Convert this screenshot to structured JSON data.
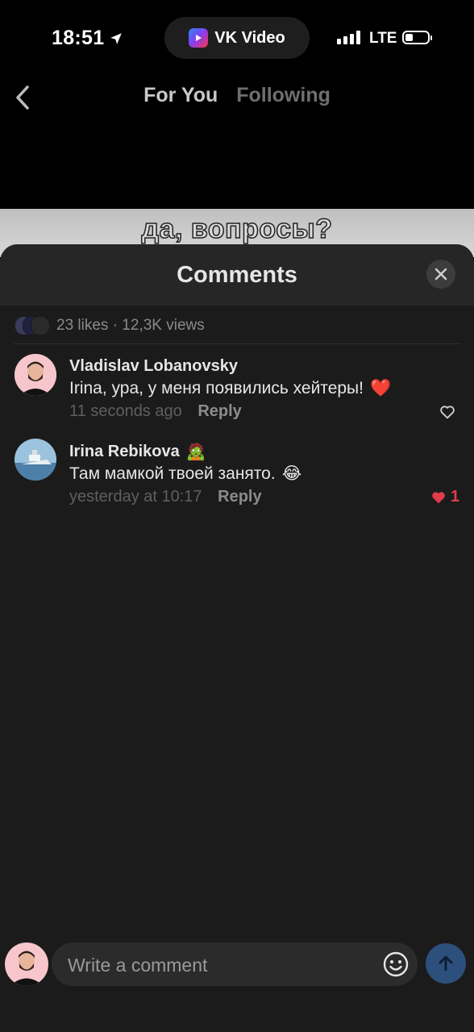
{
  "status_bar": {
    "time": "18:51",
    "network": "LTE",
    "app_pill": "VK Video"
  },
  "nav": {
    "tabs": [
      {
        "label": "For You",
        "active": true
      },
      {
        "label": "Following",
        "active": false
      }
    ]
  },
  "video": {
    "caption": "да, вопросы?"
  },
  "comments_sheet": {
    "title": "Comments",
    "stats": "23 likes · 12,3K views",
    "comments": [
      {
        "author": "Vladislav Lobanovsky",
        "text": "Irina, ура, у меня появились хейтеры!",
        "text_emoji": "❤️",
        "time": "11 seconds ago",
        "reply_label": "Reply",
        "liked": false,
        "like_count": ""
      },
      {
        "author": "Irina Rebikova",
        "author_emoji": "🧟",
        "text": "Там мамкой твоей занято.",
        "text_emoji": "😂",
        "time": "yesterday at 10:17",
        "reply_label": "Reply",
        "liked": true,
        "like_count": "1"
      }
    ]
  },
  "composer": {
    "placeholder": "Write a comment"
  },
  "colors": {
    "sheet_bg": "#1b1b1b",
    "header_bg": "#262626",
    "like_red": "#e23b4a",
    "send_blue": "#2c4f7c"
  }
}
